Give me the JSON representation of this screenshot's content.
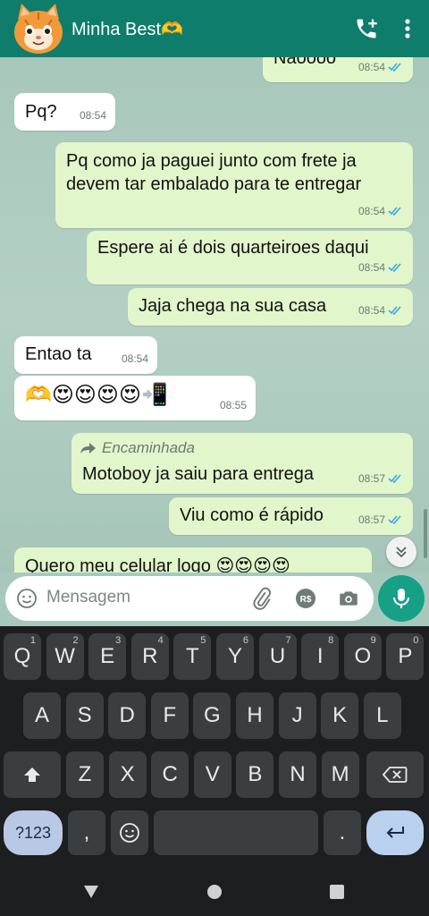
{
  "header": {
    "contact_name": "Minha Best🫶",
    "call_icon": "add-call-icon",
    "menu_icon": "more-vert-icon"
  },
  "messages": [
    {
      "dir": "out",
      "text": "Naoooo",
      "time": "08:54",
      "status": "read"
    },
    {
      "dir": "in",
      "text": "Pq?",
      "time": "08:54"
    },
    {
      "dir": "out",
      "text": "Pq como ja paguei junto com frete ja devem tar embalado para te entregar",
      "time": "08:54",
      "status": "read"
    },
    {
      "dir": "out",
      "text": "Espere ai é dois quarteiroes daqui",
      "time": "08:54",
      "status": "read"
    },
    {
      "dir": "out",
      "text": "Jaja chega na sua casa",
      "time": "08:54",
      "status": "read"
    },
    {
      "dir": "in",
      "text": "Entao ta",
      "time": "08:54"
    },
    {
      "dir": "in",
      "text": "🫶😍😍😍😍📲",
      "time": "08:55"
    },
    {
      "dir": "out",
      "forwarded_label": "Encaminhada",
      "text": "Motoboy ja saiu para entrega",
      "time": "08:57",
      "status": "read"
    },
    {
      "dir": "out",
      "text": "Viu como é rápido",
      "time": "08:57",
      "status": "read"
    },
    {
      "dir": "out",
      "text": "Quero meu celular logo 😍😍😍😍",
      "time": "",
      "status": "partial"
    }
  ],
  "composer": {
    "placeholder": "Mensagem",
    "pay_label": "R$"
  },
  "keyboard": {
    "row1": [
      {
        "k": "Q",
        "h": "1"
      },
      {
        "k": "W",
        "h": "2"
      },
      {
        "k": "E",
        "h": "3"
      },
      {
        "k": "R",
        "h": "4"
      },
      {
        "k": "T",
        "h": "5"
      },
      {
        "k": "Y",
        "h": "6"
      },
      {
        "k": "U",
        "h": "7"
      },
      {
        "k": "I",
        "h": "8"
      },
      {
        "k": "O",
        "h": "9"
      },
      {
        "k": "P",
        "h": "0"
      }
    ],
    "row2": [
      "A",
      "S",
      "D",
      "F",
      "G",
      "H",
      "J",
      "K",
      "L"
    ],
    "row3": [
      "Z",
      "X",
      "C",
      "V",
      "B",
      "N",
      "M"
    ],
    "sym_label": "?123",
    "comma_label": ",",
    "period_label": "."
  },
  "colors": {
    "header": "#0f7d6b",
    "chat_bg": "#a9c8bd",
    "bubble_out": "#e2f6cb",
    "bubble_in": "#ffffff",
    "read_ticks": "#39a9e6",
    "mic_button": "#16a085",
    "keyboard_bg": "#1c1e1f"
  }
}
